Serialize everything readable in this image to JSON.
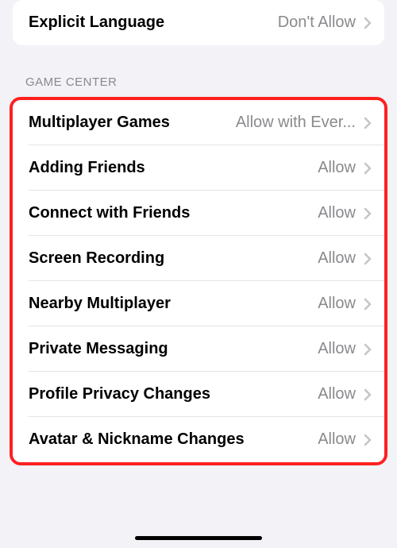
{
  "top_group": {
    "explicit_language": {
      "label": "Explicit Language",
      "value": "Don't Allow"
    }
  },
  "game_center": {
    "header": "Game Center",
    "rows": {
      "multiplayer_games": {
        "label": "Multiplayer Games",
        "value": "Allow with Ever..."
      },
      "adding_friends": {
        "label": "Adding Friends",
        "value": "Allow"
      },
      "connect_with_friends": {
        "label": "Connect with Friends",
        "value": "Allow"
      },
      "screen_recording": {
        "label": "Screen Recording",
        "value": "Allow"
      },
      "nearby_multiplayer": {
        "label": "Nearby Multiplayer",
        "value": "Allow"
      },
      "private_messaging": {
        "label": "Private Messaging",
        "value": "Allow"
      },
      "profile_privacy_changes": {
        "label": "Profile Privacy Changes",
        "value": "Allow"
      },
      "avatar_nickname_changes": {
        "label": "Avatar & Nickname Changes",
        "value": "Allow"
      }
    }
  }
}
